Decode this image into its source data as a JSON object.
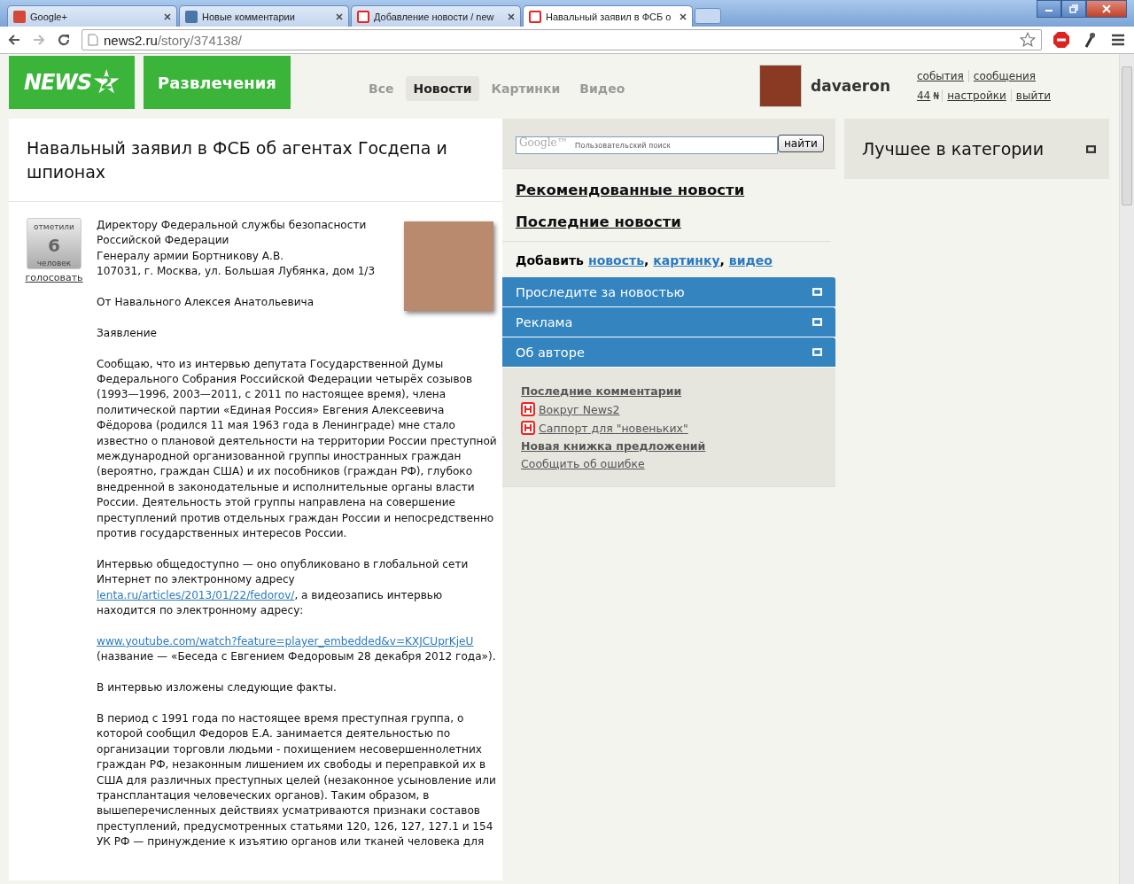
{
  "browser": {
    "tabs": [
      {
        "title": "Google+",
        "selected": false
      },
      {
        "title": "Новые комментарии",
        "selected": false
      },
      {
        "title": "Добавление новости / new",
        "selected": false
      },
      {
        "title": "Навальный заявил в ФСБ о",
        "selected": true
      }
    ],
    "url_host": "news2.ru",
    "url_path": "/story/374138/"
  },
  "header": {
    "logo": "NEWS",
    "logo_badge": "2",
    "section": "Развлечения",
    "nav": [
      {
        "label": "Все",
        "selected": false
      },
      {
        "label": "Новости",
        "selected": true
      },
      {
        "label": "Картинки",
        "selected": false
      },
      {
        "label": "Видео",
        "selected": false
      }
    ],
    "user": {
      "name": "davaeron",
      "links_top": [
        "события",
        "сообщения"
      ],
      "karma": "44",
      "currency": "₦",
      "links_bottom": [
        "настройки",
        "выйти"
      ]
    }
  },
  "story": {
    "title": "Навальный заявил в ФСБ об агентах Госдепа и шпионах",
    "votes": {
      "caption_top": "отметили",
      "count": "6",
      "caption_bottom": "человек",
      "action": "голосовать"
    },
    "paragraphs": [
      {
        "kind": "lines",
        "lines": [
          "Директору Федеральной службы безопасности",
          "Российской Федерации",
          "Генералу армии Бортникову А.В.",
          "107031, г. Москва, ул. Большая Лубянка, дом 1/3"
        ]
      },
      {
        "kind": "text",
        "parts": [
          {
            "kind": "text",
            "text": "От Навального Алексея Анатольевича"
          }
        ]
      },
      {
        "kind": "text",
        "parts": [
          {
            "kind": "text",
            "text": "Заявление"
          }
        ]
      },
      {
        "kind": "text",
        "parts": [
          {
            "kind": "text",
            "text": "Сообщаю, что из интервью депутата Государственной Думы Федерального Собрания Российской Федерации четырёх созывов (1993—1996, 2003—2011, с 2011 по настоящее время), члена политической партии «Единая Россия» Евгения Алексеевича Фёдорова (родился 11 мая 1963 года в Ленинграде) мне стало известно о плановой деятельности на территории России преступной международной организованной группы иностранных граждан (вероятно, граждан США) и их пособников (граждан РФ), глубоко внедренной в законодательные и исполнительные органы власти России. Деятельность этой группы направлена на совершение преступлений против отдельных граждан России и непосредственно против государственных интересов России."
          }
        ]
      },
      {
        "kind": "text",
        "parts": [
          {
            "kind": "text",
            "text": "Интервью общедоступно — оно опубликовано в глобальной сети Интернет по электронному адресу "
          },
          {
            "kind": "link",
            "text": "lenta.ru/articles/2013/01/22/fedorov/"
          },
          {
            "kind": "text",
            "text": ", а видеозапись интервью находится по электронному адресу:"
          }
        ]
      },
      {
        "kind": "text",
        "parts": [
          {
            "kind": "link",
            "text": "www.youtube.com/watch?feature=player_embedded&v=KXJCUprKjeU"
          },
          {
            "kind": "text",
            "text": " (название — «Беседа с Евгением Федоровым 28 декабря 2012 года»)."
          }
        ]
      },
      {
        "kind": "text",
        "parts": [
          {
            "kind": "text",
            "text": "В интервью изложены следующие факты."
          }
        ]
      },
      {
        "kind": "text",
        "parts": [
          {
            "kind": "text",
            "text": "В период с 1991 года по настоящее время преступная группа, о которой сообщил Федоров Е.А. занимается деятельностью по организации торговли людьми - похищением несовершеннолетних граждан РФ, незаконным лишением их свободы и переправкой их в США для различных преступных целей (незаконное усыновление или трансплантация человеческих органов). Таким образом, в вышеперечисленных действиях усматриваются признаки составов преступлений, предусмотренных статьями 120, 126, 127, 127.1 и 154 УК РФ — принуждение к изъятию органов или тканей человека для"
          }
        ]
      }
    ]
  },
  "sidebar": {
    "search": {
      "brand": "Google™",
      "placeholder": "Пользовательский поиск",
      "button": "найти"
    },
    "links": [
      "Рекомендованные новости",
      "Последние новости"
    ],
    "add": {
      "label": "Добавить",
      "options": [
        "новость",
        "картинку",
        "видео"
      ],
      "separator": ","
    },
    "panels": [
      {
        "title": "Проследите за новостью"
      },
      {
        "title": "Реклама"
      },
      {
        "title": "Об авторе"
      }
    ],
    "menu": [
      {
        "kind": "heading",
        "label": "Последние комментарии"
      },
      {
        "kind": "forum",
        "label": "Вокруг News2"
      },
      {
        "kind": "forum",
        "label": "Саппорт для \"новеньких\""
      },
      {
        "kind": "heading",
        "label": "Новая книжка предложений"
      },
      {
        "kind": "plain",
        "label": "Сообщить об ошибке"
      }
    ]
  },
  "best": {
    "title": "Лучшее в категории"
  }
}
